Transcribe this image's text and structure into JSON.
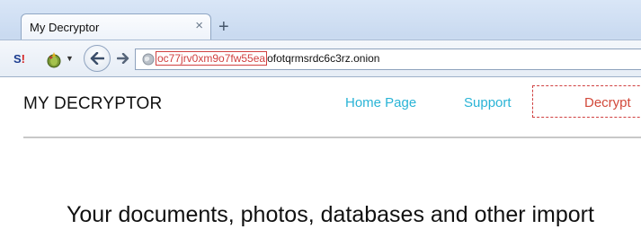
{
  "browser": {
    "tab": {
      "title": "My Decryptor",
      "close_glyph": "×"
    },
    "new_tab_glyph": "+",
    "addons": {
      "first_label": "S",
      "first_suffix": "!",
      "caret": "▼"
    },
    "url": {
      "highlighted": "oc77jrv0xm9o7fw55ea",
      "rest": "ofotqrmsrdc6c3rz.onion"
    }
  },
  "site": {
    "brand": "MY DECRYPTOR",
    "nav": {
      "home": "Home Page",
      "support": "Support",
      "decrypt": "Decrypt"
    },
    "headline": "Your documents, photos, databases and other import"
  },
  "colors": {
    "link": "#2ab4d6",
    "decrypt": "#d24a3b",
    "highlight": "#d04040"
  }
}
